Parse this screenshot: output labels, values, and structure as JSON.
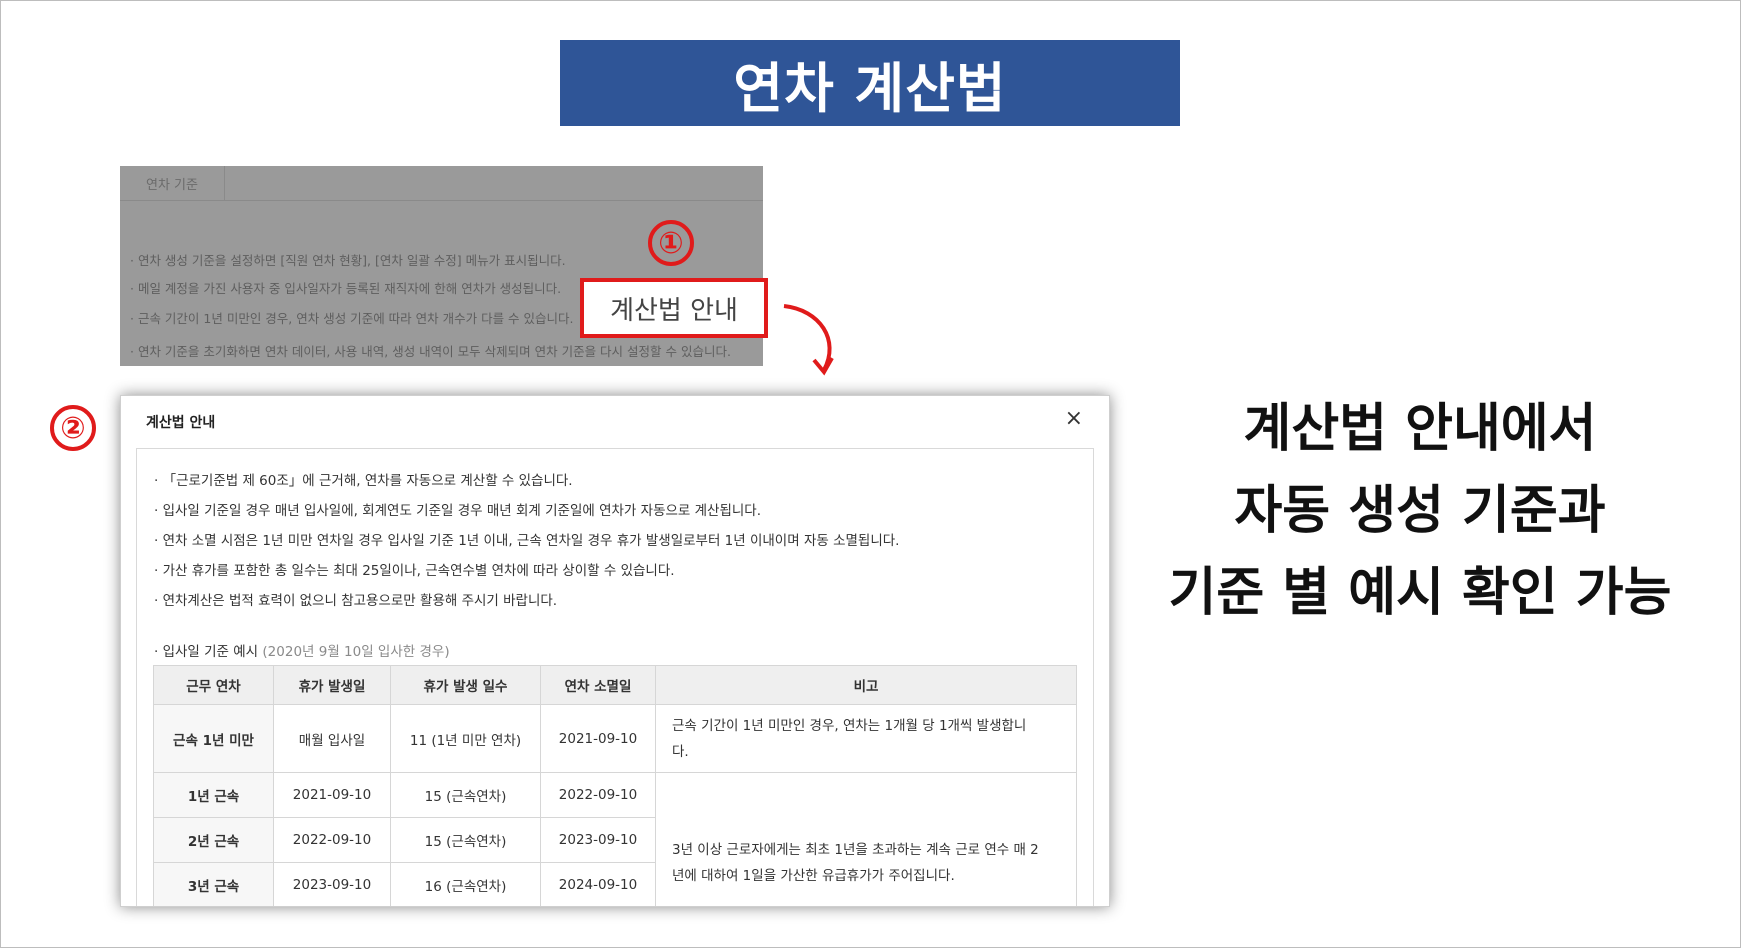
{
  "title": "연차 계산법",
  "settings": {
    "tab_label": "연차 기준",
    "notes": [
      "· 연차 생성 기준을 설정하면 [직원 연차 현황], [연차 일괄 수정] 메뉴가 표시됩니다.",
      "· 메일 계정을 가진 사용자 중 입사일자가 등록된 재직자에 한해 연차가 생성됩니다.",
      "· 근속 기간이 1년 미만인 경우, 연차 생성 기준에 따라 연차 개수가 다를 수 있습니다.",
      "· 연차 기준을 초기화하면 연차 데이터, 사용 내역, 생성 내역이 모두 삭제되며 연차 기준을 다시 설정할 수 있습니다."
    ],
    "guide_button": "계산법 안내"
  },
  "markers": {
    "one": "①",
    "two": "②"
  },
  "modal": {
    "title": "계산법 안내",
    "close": "×",
    "bullets": [
      "· 「근로기준법 제 60조」에 근거해, 연차를 자동으로 계산할 수 있습니다.",
      "· 입사일 기준일 경우 매년 입사일에, 회계연도 기준일 경우 매년 회계 기준일에 연차가 자동으로 계산됩니다.",
      "· 연차 소멸 시점은 1년 미만 연차일 경우 입사일 기준 1년 이내, 근속 연차일 경우 휴가 발생일로부터 1년 이내이며 자동 소멸됩니다.",
      "· 가산 휴가를 포함한 총 일수는 최대 25일이나, 근속연수별 연차에 따라 상이할 수 있습니다.",
      "· 연차계산은 법적 효력이 없으니 참고용으로만 활용해 주시기 바랍니다."
    ],
    "example_label": "· 입사일 기준 예시",
    "example_sub": "(2020년 9월 10일 입사한 경우)",
    "headers": [
      "근무 연차",
      "휴가 발생일",
      "휴가 발생 일수",
      "연차 소멸일",
      "비고"
    ],
    "rows": [
      [
        "근속 1년 미만",
        "매월 입사일",
        "11 (1년 미만 연차)",
        "2021-09-10"
      ],
      [
        "1년 근속",
        "2021-09-10",
        "15 (근속연차)",
        "2022-09-10"
      ],
      [
        "2년 근속",
        "2022-09-10",
        "15 (근속연차)",
        "2023-09-10"
      ],
      [
        "3년 근속",
        "2023-09-10",
        "16 (근속연차)",
        "2024-09-10"
      ]
    ],
    "note_first_line1": "근속 기간이 1년 미만인 경우, 연차는 1개월 당 1개씩 발생합니",
    "note_first_line2": "다.",
    "note_rest_line1": "3년 이상 근로자에게는 최초 1년을 초과하는 계속 근로 연수 매 2",
    "note_rest_line2": "년에 대하여 1일을 가산한 유급휴가가 주어집니다."
  },
  "side_text": [
    "계산법 안내에서",
    "자동 생성 기준과",
    "기준 별 예시 확인 가능"
  ],
  "colors": {
    "title_bg": "#2f5597",
    "highlight_red": "#e01b1b",
    "dim_overlay": "#9a9a9a"
  }
}
